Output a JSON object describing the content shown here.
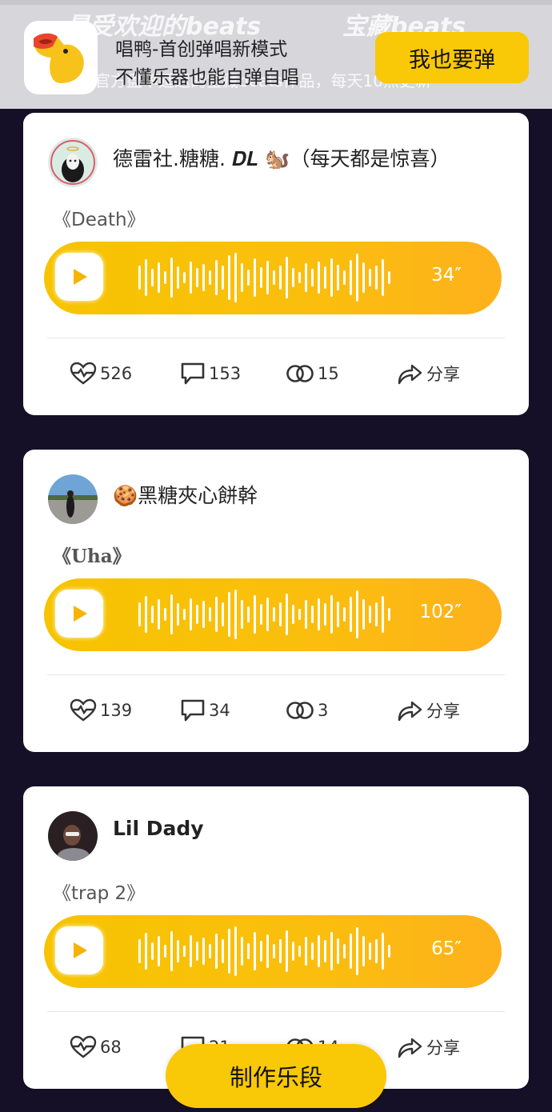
{
  "banner": {
    "bg_tab_popular": "最受欢迎的beats",
    "bg_tab_treasure": "宝藏beats",
    "bg_subtitle": "官方盘率延迟的宝藏beats作品，每天10点更新",
    "app_title": "唱鸭-首创弹唱新模式",
    "app_subtitle": "不懂乐器也能自弹自唱",
    "cta_label": "我也要弹",
    "app_icon": "duck-icon"
  },
  "posts": [
    {
      "author": "德雷社.糖糖. 𝑫𝑳 🐿️（每天都是惊喜）",
      "song": "《Death》",
      "duration": "34″",
      "likes": "526",
      "comments": "153",
      "duets": "15",
      "share": "分享"
    },
    {
      "author": "🍪黑糖夾心餅幹",
      "song": "《Uha》",
      "duration": "102″",
      "likes": "139",
      "comments": "34",
      "duets": "3",
      "share": "分享"
    },
    {
      "author": "Lil Dady",
      "song": "《trap 2》",
      "duration": "65″",
      "likes": "68",
      "comments": "21",
      "duets": "14",
      "share": "分享"
    }
  ],
  "bottom": {
    "make_label": "制作乐段"
  },
  "colors": {
    "accent": "#f9c806",
    "background": "#150f27",
    "card": "#ffffff"
  }
}
